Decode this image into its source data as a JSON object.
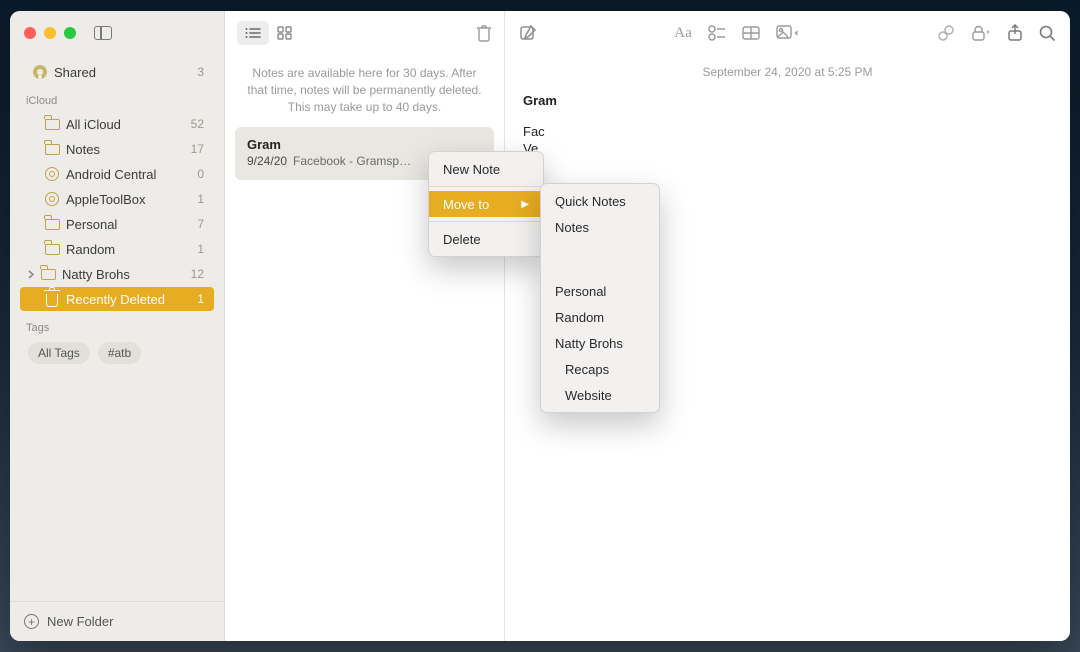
{
  "sidebar": {
    "shared": {
      "label": "Shared",
      "count": 3
    },
    "section_icloud": "iCloud",
    "items": [
      {
        "label": "All iCloud",
        "count": 52,
        "type": "folder"
      },
      {
        "label": "Notes",
        "count": 17,
        "type": "folder"
      },
      {
        "label": "Android Central",
        "count": 0,
        "type": "smart"
      },
      {
        "label": "AppleToolBox",
        "count": 1,
        "type": "smart"
      },
      {
        "label": "Personal",
        "count": 7,
        "type": "folder"
      },
      {
        "label": "Random",
        "count": 1,
        "type": "folder"
      },
      {
        "label": "Natty Brohs",
        "count": 12,
        "type": "folder",
        "expandable": true
      },
      {
        "label": "Recently Deleted",
        "count": 1,
        "type": "trash",
        "selected": true
      }
    ],
    "tags_header": "Tags",
    "tags": [
      "All Tags",
      "#atb"
    ],
    "new_folder": "New Folder"
  },
  "notelist": {
    "notice": "Notes are available here for 30 days. After that time, notes will be permanently deleted. This may take up to 40 days.",
    "note": {
      "title": "Gram",
      "date": "9/24/20",
      "preview": "Facebook - Gramsp…"
    }
  },
  "editor": {
    "timestamp": "September 24, 2020 at 5:25 PM",
    "title": "Gram",
    "lines": [
      "Fac",
      "Ve"
    ]
  },
  "context_menu": {
    "new_note": "New Note",
    "move_to": "Move to",
    "delete": "Delete"
  },
  "submenu": {
    "items_top": [
      "Quick Notes",
      "Notes"
    ],
    "items_bottom": [
      "Personal",
      "Random",
      "Natty Brohs"
    ],
    "nested": [
      "Recaps",
      "Website"
    ]
  }
}
